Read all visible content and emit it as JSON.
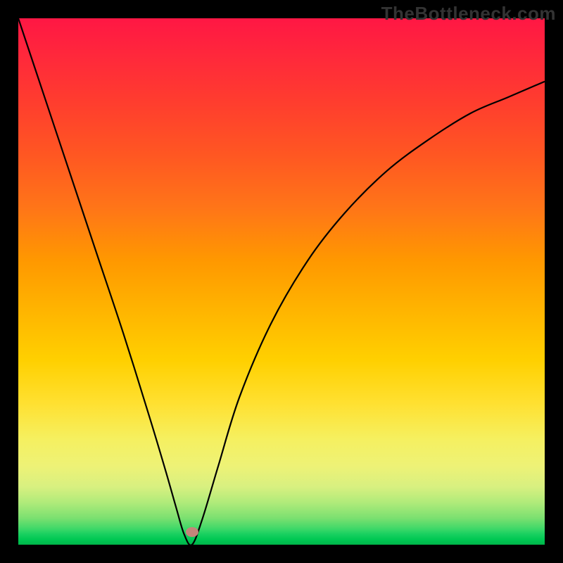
{
  "watermark": "TheBottleneck.com",
  "chart_data": {
    "type": "line",
    "title": "",
    "xlabel": "",
    "ylabel": "",
    "xlim": [
      0,
      100
    ],
    "ylim": [
      0,
      100
    ],
    "series": [
      {
        "name": "bottleneck-curve",
        "x": [
          0,
          5,
          10,
          15,
          20,
          25,
          28,
          30,
          31.5,
          33,
          35,
          38,
          42,
          48,
          55,
          62,
          70,
          78,
          86,
          93,
          100
        ],
        "y": [
          100,
          85,
          70,
          55,
          40,
          24,
          14,
          7,
          2,
          0,
          5,
          15,
          28,
          42,
          54,
          63,
          71,
          77,
          82,
          85,
          88
        ]
      }
    ],
    "marker": {
      "x": 33,
      "y": 0,
      "color": "#c4857a"
    },
    "background_gradient": {
      "top": "#ff1744",
      "middle": "#ffd000",
      "bottom": "#00c853"
    }
  },
  "plot": {
    "marker_left_pct": 33.0,
    "marker_bottom_pct": 0.5
  }
}
